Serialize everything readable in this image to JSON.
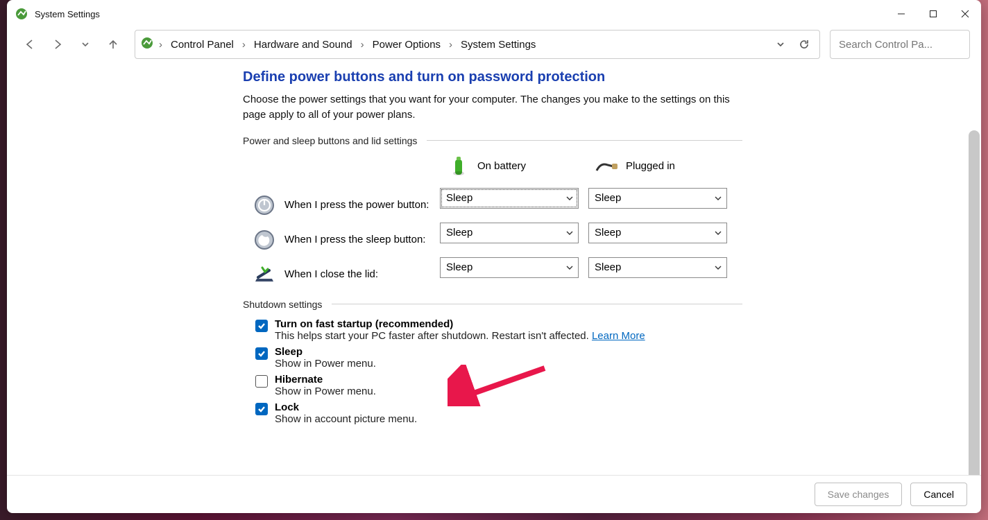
{
  "window": {
    "title": "System Settings"
  },
  "breadcrumb": {
    "items": [
      "Control Panel",
      "Hardware and Sound",
      "Power Options",
      "System Settings"
    ]
  },
  "search": {
    "placeholder": "Search Control Pa..."
  },
  "page": {
    "title": "Define power buttons and turn on password protection",
    "description": "Choose the power settings that you want for your computer. The changes you make to the settings on this page apply to all of your power plans."
  },
  "groups": {
    "buttons_header": "Power and sleep buttons and lid settings",
    "columns": {
      "battery": "On battery",
      "plugged": "Plugged in"
    },
    "rows": {
      "power": {
        "label": "When I press the power button:",
        "battery": "Sleep",
        "plugged": "Sleep"
      },
      "sleep": {
        "label": "When I press the sleep button:",
        "battery": "Sleep",
        "plugged": "Sleep"
      },
      "lid": {
        "label": "When I close the lid:",
        "battery": "Sleep",
        "plugged": "Sleep"
      }
    },
    "shutdown_header": "Shutdown settings"
  },
  "shutdown": {
    "fast": {
      "title": "Turn on fast startup (recommended)",
      "sub": "This helps start your PC faster after shutdown. Restart isn't affected. ",
      "learn": "Learn More",
      "checked": true
    },
    "sleep": {
      "title": "Sleep",
      "sub": "Show in Power menu.",
      "checked": true
    },
    "hibernate": {
      "title": "Hibernate",
      "sub": "Show in Power menu.",
      "checked": false
    },
    "lock": {
      "title": "Lock",
      "sub": "Show in account picture menu.",
      "checked": true
    }
  },
  "footer": {
    "save": "Save changes",
    "cancel": "Cancel"
  }
}
